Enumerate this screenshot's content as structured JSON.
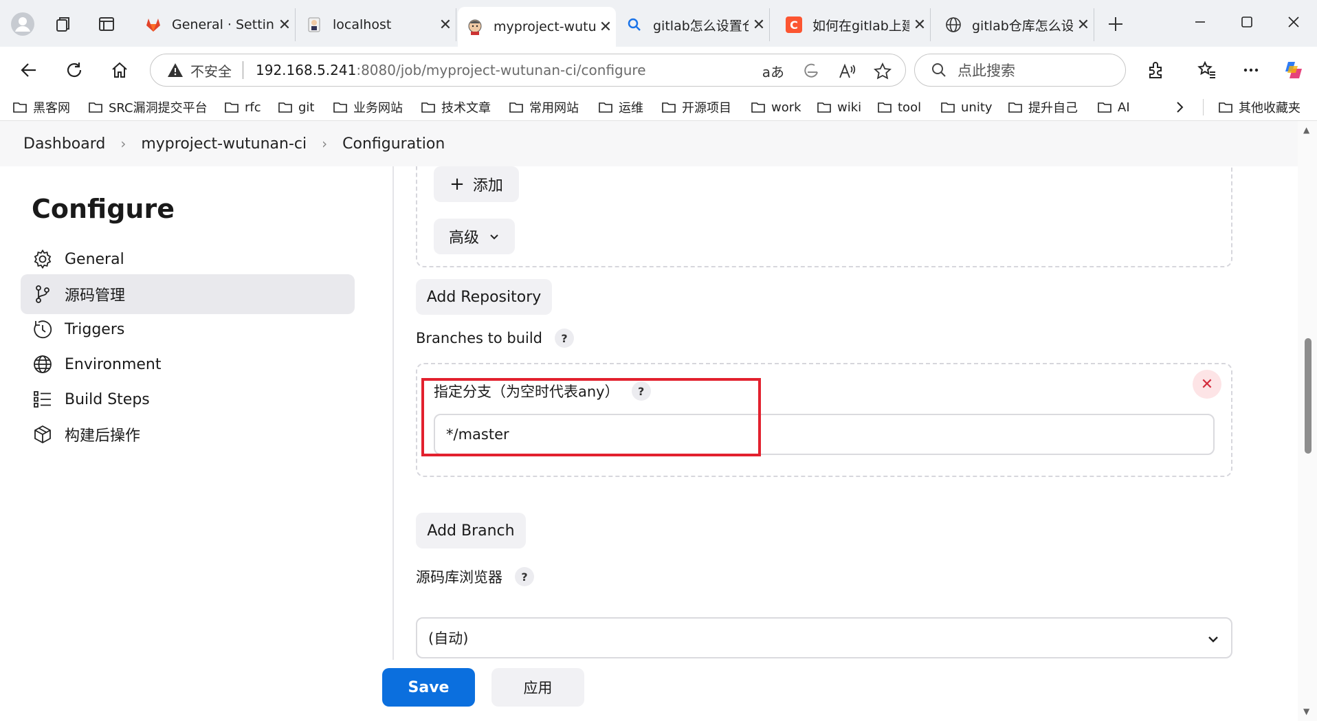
{
  "browser": {
    "tabs": [
      {
        "title": "General · Settings",
        "favicon": "gitlab-icon",
        "active": false
      },
      {
        "title": "localhost",
        "favicon": "jenkins-icon",
        "active": false
      },
      {
        "title": "myproject-wutunan-ci",
        "favicon": "jenkins-icon",
        "active": true
      },
      {
        "title": "gitlab怎么设置仓库",
        "favicon": "search-icon",
        "active": false
      },
      {
        "title": "如何在gitlab上建立",
        "favicon": "csdn-icon",
        "active": false
      },
      {
        "title": "gitlab仓库怎么设置",
        "favicon": "globe-icon",
        "active": false
      }
    ],
    "address": {
      "security_label": "不安全",
      "url_host": "192.168.5.241",
      "url_rest": ":8080/job/myproject-wutunan-ci/configure"
    },
    "search_placeholder": "点此搜索",
    "bookmarks": [
      "黑客网",
      "SRC漏洞提交平台",
      "rfc",
      "git",
      "业务网站",
      "技术文章",
      "常用网站",
      "运维",
      "开源项目",
      "work",
      "wiki",
      "tool",
      "unity",
      "提升自己",
      "AI"
    ],
    "other_bookmarks": "其他收藏夹"
  },
  "breadcrumb": {
    "items": [
      "Dashboard",
      "myproject-wutunan-ci",
      "Configuration"
    ]
  },
  "sidebar": {
    "title": "Configure",
    "items": [
      {
        "label": "General",
        "icon": "gear-icon",
        "active": false
      },
      {
        "label": "源码管理",
        "icon": "branch-icon",
        "active": true
      },
      {
        "label": "Triggers",
        "icon": "clock-icon",
        "active": false
      },
      {
        "label": "Environment",
        "icon": "globe-icon",
        "active": false
      },
      {
        "label": "Build Steps",
        "icon": "list-icon",
        "active": false
      },
      {
        "label": "构建后操作",
        "icon": "package-icon",
        "active": false
      }
    ]
  },
  "main": {
    "add_label": "添加",
    "add_icon": "plus-icon",
    "advanced_label": "高级",
    "add_repository_label": "Add Repository",
    "branches_label": "Branches to build",
    "branch_spec_label": "指定分支（为空时代表any）",
    "branch_spec_value": "*/master",
    "add_branch_label": "Add Branch",
    "repo_browser_label": "源码库浏览器",
    "repo_browser_value": "(自动)",
    "help_glyph": "?",
    "remove_glyph": "✕",
    "save_label": "Save",
    "apply_label": "应用"
  },
  "colors": {
    "primary": "#0b6fde",
    "highlight_border": "#e2212e",
    "danger": "#d3293a"
  }
}
